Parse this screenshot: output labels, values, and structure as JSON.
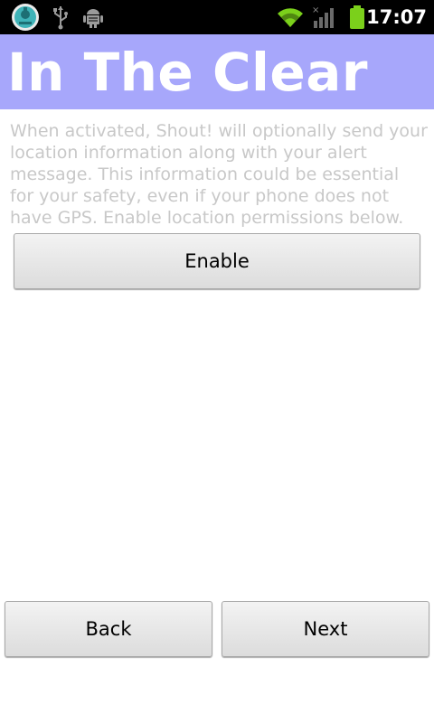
{
  "status_bar": {
    "time": "17:07",
    "icons": [
      "app-notification-icon",
      "usb-icon",
      "android-debug-icon",
      "wifi-icon",
      "signal-icon",
      "battery-icon"
    ]
  },
  "header": {
    "title": "In The Clear",
    "background": "#a7a7fb"
  },
  "main": {
    "description": "When activated, Shout! will optionally send your location information along with your alert message. This information could be essential for your safety, even if your phone does not have GPS. Enable location permissions below.",
    "enable_label": "Enable"
  },
  "footer": {
    "back_label": "Back",
    "next_label": "Next"
  }
}
